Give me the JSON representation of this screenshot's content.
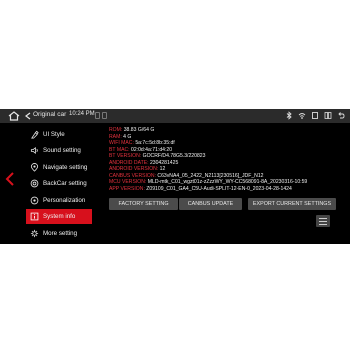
{
  "status_bar": {
    "title": "Original car",
    "time": "10:24 PM"
  },
  "menu": [
    {
      "label": "UI Style",
      "icon": "ui-style-icon",
      "active": false
    },
    {
      "label": "Sound setting",
      "icon": "sound-icon",
      "active": false
    },
    {
      "label": "Navigate setting",
      "icon": "navigate-icon",
      "active": false
    },
    {
      "label": "BackCar setting",
      "icon": "backcar-icon",
      "active": false
    },
    {
      "label": "Personalization",
      "icon": "personalization-icon",
      "active": false
    },
    {
      "label": "System info",
      "icon": "system-info-icon",
      "active": true
    },
    {
      "label": "More setting",
      "icon": "more-setting-icon",
      "active": false
    }
  ],
  "info": [
    {
      "key": "ROM:",
      "value": " 38.83 G/64 G"
    },
    {
      "key": "RAM:",
      "value": " 4 G"
    },
    {
      "key": "WIFI MAC:",
      "value": " 5a:7c:5d:8b:35:df"
    },
    {
      "key": "BT MAC:",
      "value": " 02:0d:4a:71:d4:20"
    },
    {
      "key": "BT VERSION:",
      "value": " GOCRF/D4.78G5.3/220823"
    },
    {
      "key": "ANDROID DATE:",
      "value": " 2304281425"
    },
    {
      "key": "ANDROID VERSION:",
      "value": " 12"
    },
    {
      "key": "CANBUS VERSION:",
      "value": " C63vNA4_05_2422_N2113[230516]_JDF_N12"
    },
    {
      "key": "MCU VERSION:",
      "value": " MLD-mtk_C01_wgzt01z-zZzzWY_WY-CC568091-8A_20230316-10:59"
    },
    {
      "key": "APP VERSION:",
      "value": " Z09109_C01_GA4_C5U-Audi-SPLIT-12-EN-0_2023-04-28-1424"
    }
  ],
  "buttons": {
    "factory": "FACTORY SETTING",
    "canbus": "CANBUS UPDATE",
    "export": "EXPORT CURRENT SETTINGS"
  },
  "colors": {
    "accent": "#d7101c",
    "key_text": "#e2313d",
    "background": "#000000"
  }
}
